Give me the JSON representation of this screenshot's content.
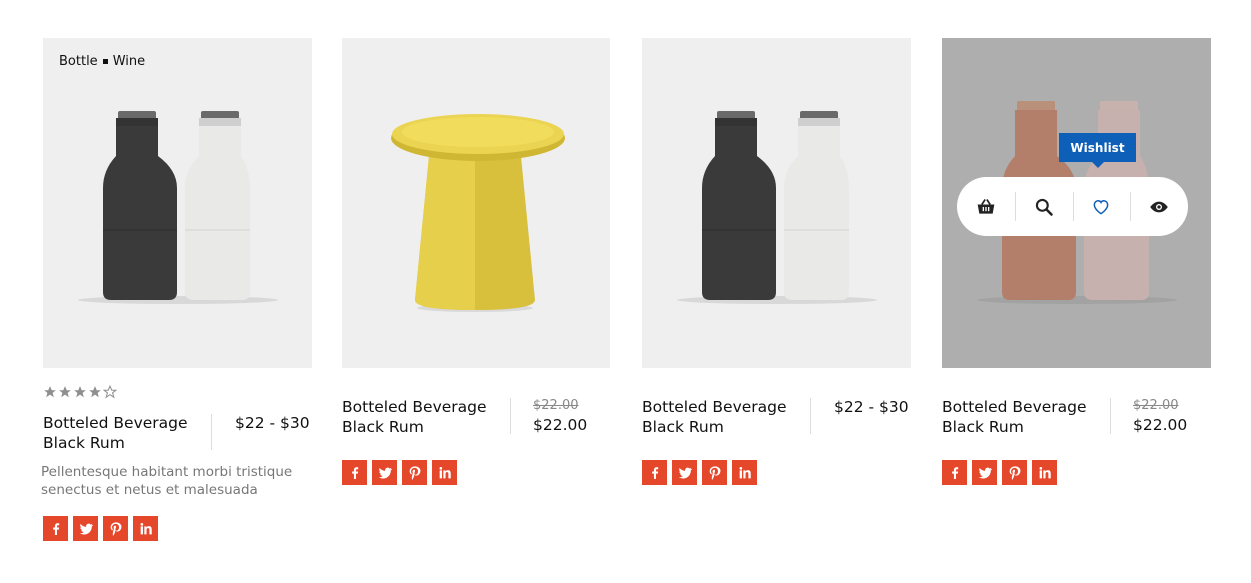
{
  "products": [
    {
      "category": "Bottle",
      "category2": "Wine",
      "title": "Botteled Beverage Black Rum",
      "price": "$22 - $30",
      "rating": 4,
      "rating_max": 5,
      "description": "Pellentesque habitant morbi tristique senectus et netus et malesuada"
    },
    {
      "title": "Botteled Beverage Black Rum",
      "old_price": "$22.00",
      "price": "$22.00"
    },
    {
      "title": "Botteled Beverage Black Rum",
      "price": "$22 - $30"
    },
    {
      "title": "Botteled Beverage Black Rum",
      "old_price": "$22.00",
      "price": "$22.00",
      "tooltip": "Wishlist"
    }
  ],
  "social_icons": [
    "facebook-icon",
    "twitter-icon",
    "pinterest-icon",
    "linkedin-icon"
  ],
  "action_icons": [
    "basket-icon",
    "search-icon",
    "heart-icon",
    "eye-icon"
  ],
  "colors": {
    "social_bg": "#e4472a",
    "tooltip_bg": "#0d5fb8",
    "thumb_bg": "#efefef",
    "thumb_hover_bg": "#aeaeae",
    "star_filled": "#8f8f8f"
  }
}
